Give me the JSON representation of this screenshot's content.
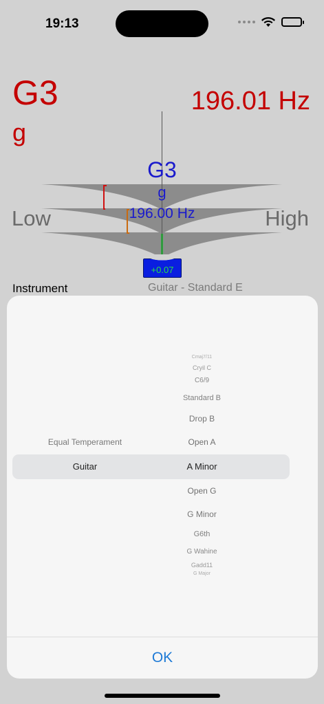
{
  "status_bar": {
    "time": "19:13"
  },
  "tuner": {
    "detected_note": "G3",
    "detected_solfege": "g",
    "detected_frequency": "196.01 Hz",
    "target_note": "G3",
    "target_solfege": "g",
    "target_frequency": "196.00 Hz",
    "low_label": "Low",
    "high_label": "High",
    "cents_offset": "+0.07"
  },
  "instrument_row": {
    "label": "Instrument",
    "value": "Guitar - Standard E"
  },
  "picker": {
    "left_column": {
      "items": [
        "Equal Temperament",
        "Guitar"
      ]
    },
    "right_column": {
      "items": [
        "Cmaj7/11",
        "Cryil C",
        "C6/9",
        "Standard B",
        "Drop B",
        "Open A",
        "A Minor",
        "Open G",
        "G Minor",
        "G6th",
        "G Wahine",
        "Gadd11",
        "G Major"
      ]
    }
  },
  "sheet": {
    "ok_label": "OK"
  },
  "colors": {
    "detected": "#c40000",
    "target": "#1a1acc",
    "badge_bg": "#0a1ee0",
    "badge_text": "#26e046",
    "accent": "#1e7ad6"
  }
}
